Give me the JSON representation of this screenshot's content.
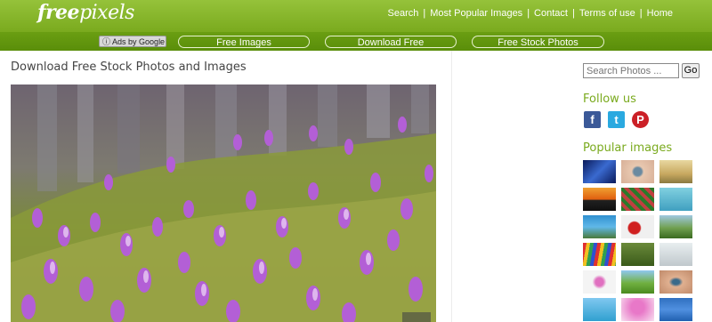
{
  "header": {
    "logo_free": "free",
    "logo_pixels": "pixels",
    "nav": [
      "Search",
      "Most Popular Images",
      "Contact",
      "Terms of use",
      "Home"
    ]
  },
  "adbar": {
    "ads_label": "Ads by Google",
    "links": [
      "Free Images",
      "Download Free",
      "Free Stock Photos"
    ]
  },
  "main": {
    "title": "Download Free Stock Photos and Images"
  },
  "sidebar": {
    "search_placeholder": "Search Photos ...",
    "search_button": "Go",
    "follow_heading": "Follow us",
    "social": [
      {
        "name": "facebook",
        "glyph": "f",
        "color": "#3b5998"
      },
      {
        "name": "twitter",
        "glyph": "t",
        "color": "#2aa9e0"
      },
      {
        "name": "pinterest",
        "glyph": "P",
        "color": "#cb2027"
      }
    ],
    "popular_heading": "Popular images"
  },
  "colors": {
    "header_green": "#8cbb2f",
    "accent_green": "#7aaa1e"
  }
}
